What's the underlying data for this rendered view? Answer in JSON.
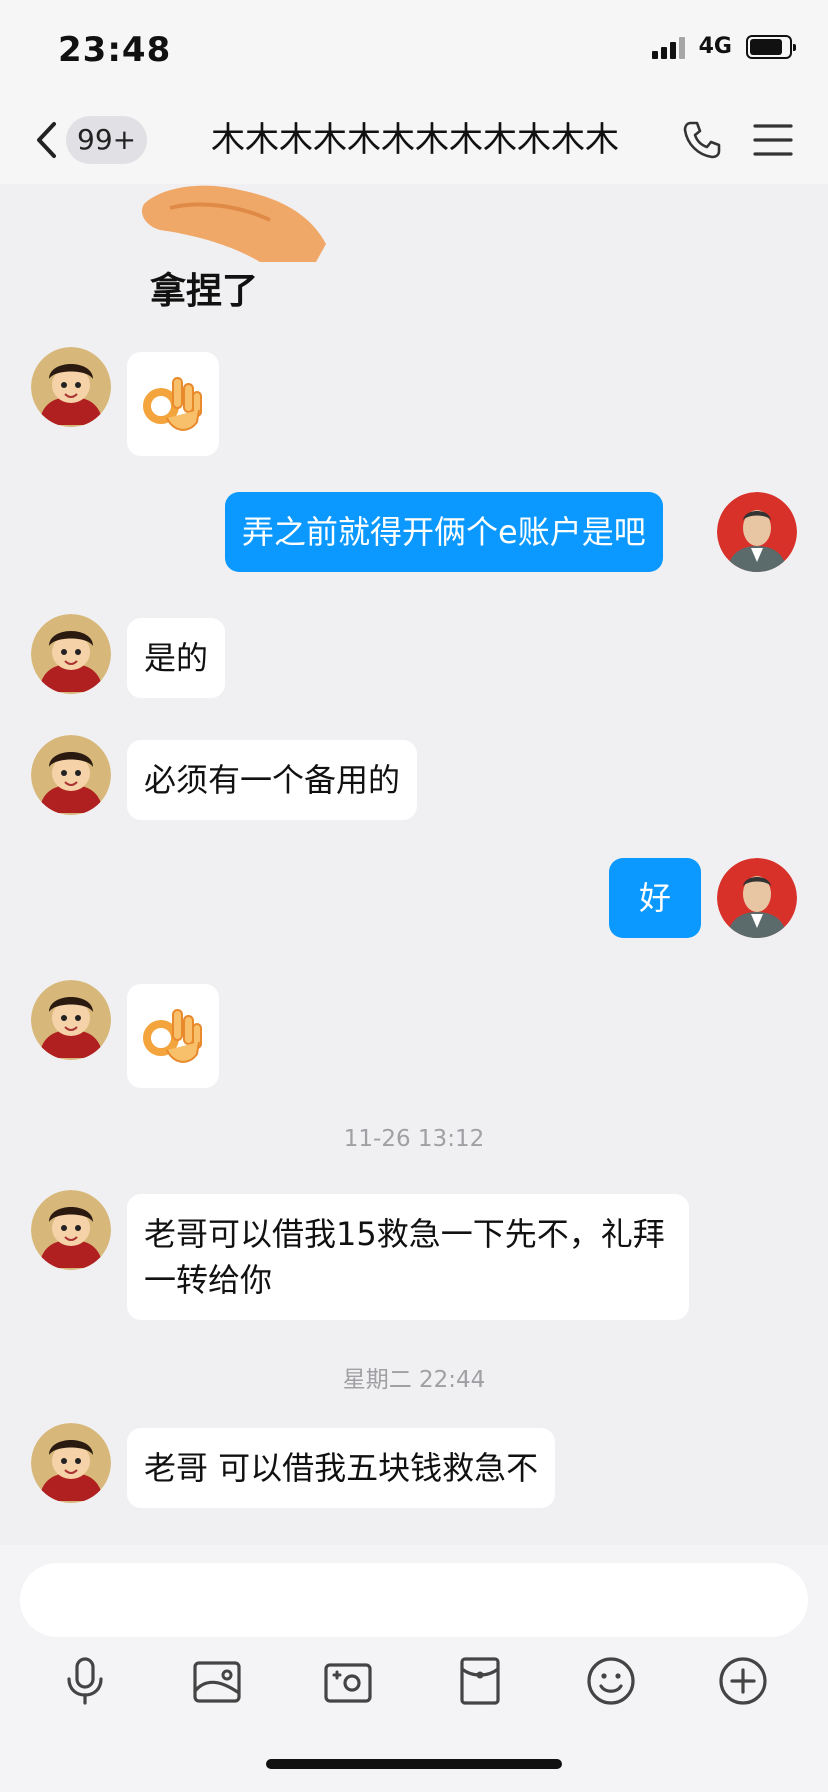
{
  "status": {
    "time": "23:48",
    "network": "4G"
  },
  "header": {
    "unread_badge": "99+",
    "contact_name": "木木木木木木木木木木木木"
  },
  "sticker": {
    "caption": "拿捏了"
  },
  "messages": [
    {
      "side": "left",
      "type": "emoji",
      "emoji": "ok-hand"
    },
    {
      "side": "right",
      "type": "text",
      "text": "弄之前就得开俩个e账户是吧"
    },
    {
      "side": "left",
      "type": "text",
      "text": "是的"
    },
    {
      "side": "left",
      "type": "text",
      "text": "必须有一个备用的"
    },
    {
      "side": "right",
      "type": "text",
      "text": "好"
    },
    {
      "side": "left",
      "type": "emoji",
      "emoji": "ok-hand"
    },
    {
      "type": "time",
      "text": "11-26 13:12"
    },
    {
      "side": "left",
      "type": "text",
      "text": "老哥可以借我15救急一下先不，礼拜一转给你"
    },
    {
      "type": "time",
      "text": "星期二 22:44"
    },
    {
      "side": "left",
      "type": "text",
      "text": "老哥 可以借我五块钱救急不"
    }
  ],
  "input": {
    "placeholder": ""
  },
  "toolbar": [
    "microphone-icon",
    "image-icon",
    "camera-icon",
    "red-packet-icon",
    "emoji-icon",
    "plus-icon"
  ],
  "colors": {
    "outgoing_bubble": "#0b99ff",
    "incoming_bubble": "#ffffff",
    "background": "#f0f0f2"
  }
}
